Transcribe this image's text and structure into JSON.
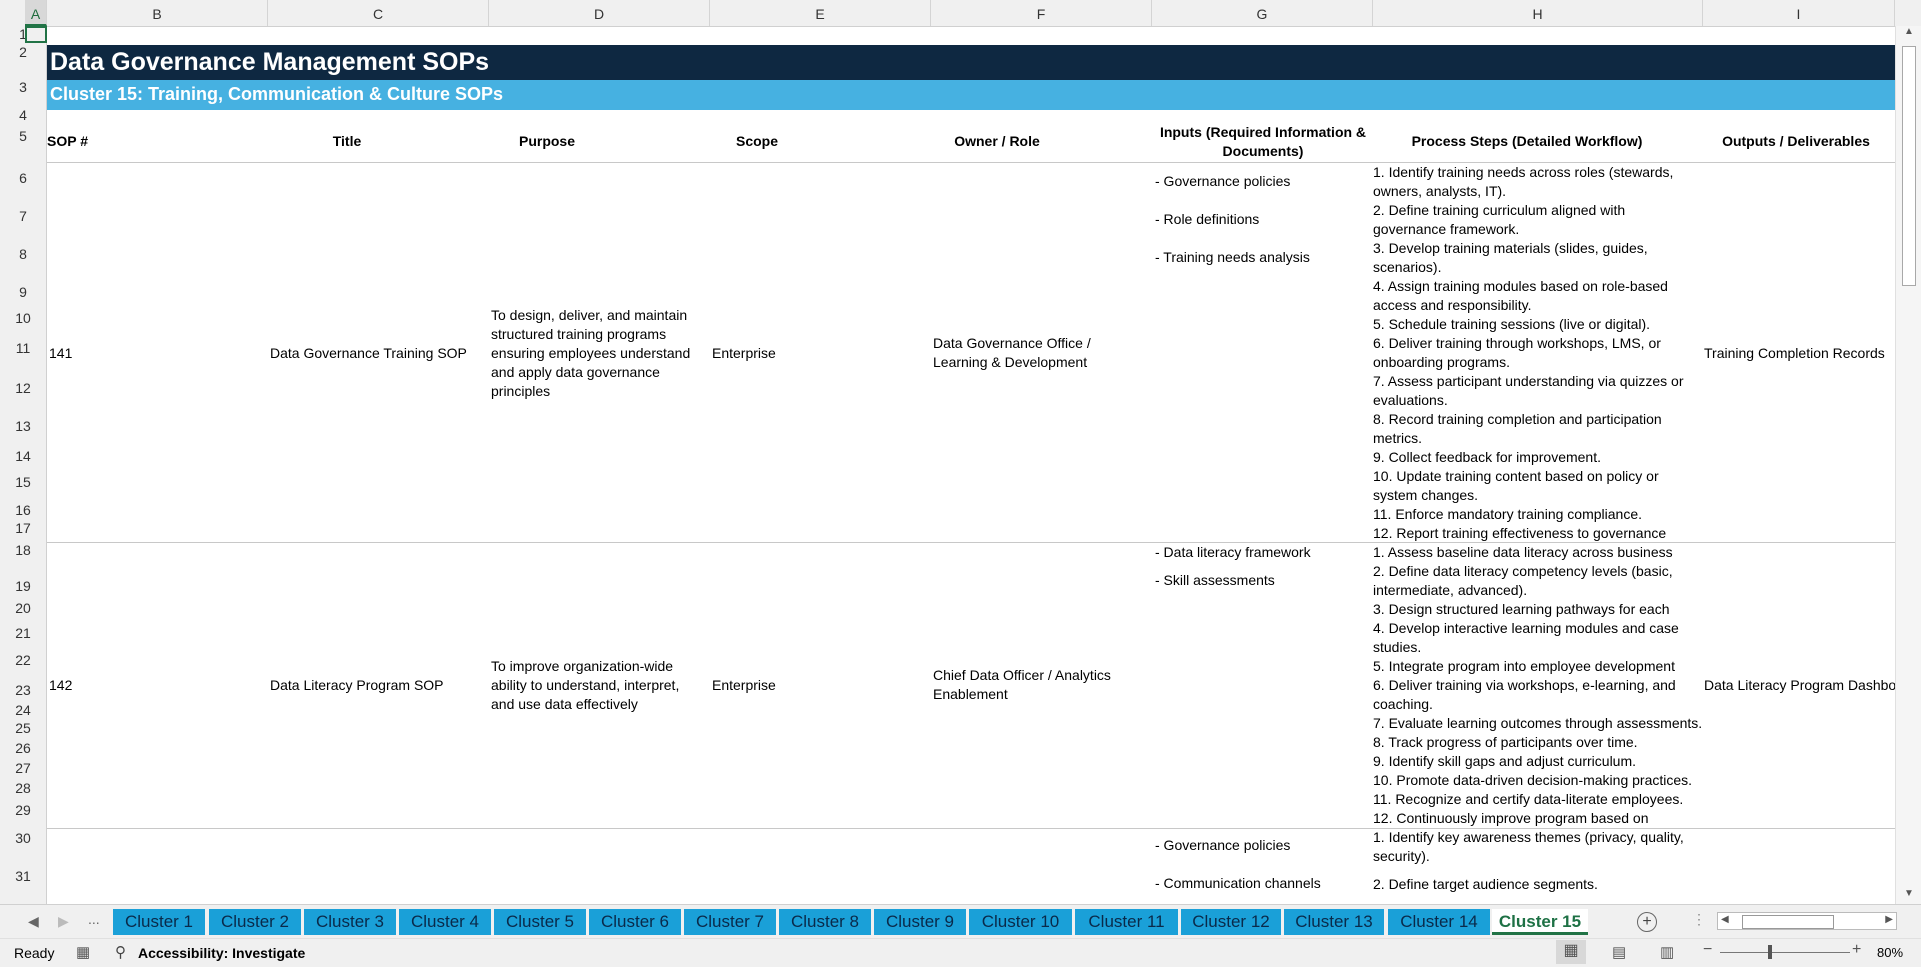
{
  "columns": [
    "A",
    "B",
    "C",
    "D",
    "E",
    "F",
    "G",
    "H",
    "I"
  ],
  "rows": [
    "1",
    "2",
    "3",
    "4",
    "5",
    "6",
    "7",
    "8",
    "9",
    "10",
    "11",
    "12",
    "13",
    "14",
    "15",
    "16",
    "17",
    "18",
    "19",
    "20",
    "21",
    "22",
    "23",
    "24",
    "25",
    "26",
    "27",
    "28",
    "29",
    "30",
    "31"
  ],
  "sheet": {
    "title": "Data Governance Management SOPs",
    "subtitle": "Cluster 15: Training, Communication & Culture SOPs",
    "headers": {
      "sop": "SOP #",
      "title": "Title",
      "purpose": "Purpose",
      "scope": "Scope",
      "owner": "Owner / Role",
      "inputs": "Inputs (Required Information & Documents)",
      "steps": "Process Steps (Detailed Workflow)",
      "outputs": "Outputs / Deliverables"
    },
    "records": [
      {
        "sop": "141",
        "title": "Data Governance Training SOP",
        "purpose": "To design, deliver, and maintain structured training programs ensuring employees understand and apply data governance principles",
        "scope": "Enterprise",
        "owner": "Data Governance Office / Learning & Development",
        "inputs": [
          "- Governance policies",
          "- Role definitions",
          "- Training needs analysis"
        ],
        "steps": [
          "1. Identify training needs across roles (stewards,",
          "owners, analysts, IT).",
          "2. Define training curriculum aligned with",
          "governance framework.",
          "3. Develop training materials (slides, guides,",
          "scenarios).",
          "4. Assign training modules based on role-based",
          "access and responsibility.",
          "5. Schedule training sessions (live or digital).",
          "6. Deliver training through workshops, LMS, or",
          "onboarding programs.",
          "7. Assess participant understanding via quizzes or",
          "evaluations.",
          "8. Record training completion and participation",
          "metrics.",
          "9. Collect feedback for improvement.",
          "10. Update training content based on policy or",
          "system changes.",
          "11. Enforce mandatory training compliance.",
          "12. Report training effectiveness to governance"
        ],
        "outputs": "Training Completion Records"
      },
      {
        "sop": "142",
        "title": "Data Literacy Program SOP",
        "purpose": "To improve organization-wide ability to understand, interpret, and use data effectively",
        "scope": "Enterprise",
        "owner": "Chief Data Officer / Analytics Enablement",
        "inputs": [
          "- Data literacy framework",
          "- Skill assessments"
        ],
        "steps": [
          "1. Assess baseline data literacy across business",
          "2. Define data literacy competency levels (basic,",
          "intermediate, advanced).",
          "3. Design structured learning pathways for each",
          "4. Develop interactive learning modules and case",
          "studies.",
          "5. Integrate program into employee development",
          "6. Deliver training via workshops, e-learning, and",
          "coaching.",
          "7. Evaluate learning outcomes through assessments.",
          "8. Track progress of participants over time.",
          "9. Identify skill gaps and adjust curriculum.",
          "10. Promote data-driven decision-making practices.",
          "11. Recognize and certify data-literate employees.",
          "12. Continuously improve program based on"
        ],
        "outputs": "Data Literacy Program Dashboa"
      },
      {
        "inputs": [
          "- Governance policies",
          "- Communication channels"
        ],
        "steps": [
          "1. Identify key awareness themes (privacy, quality,",
          "security).",
          "2. Define target audience segments."
        ]
      }
    ]
  },
  "tabs": [
    "Cluster 1",
    "Cluster 2",
    "Cluster 3",
    "Cluster 4",
    "Cluster 5",
    "Cluster 6",
    "Cluster 7",
    "Cluster 8",
    "Cluster 9",
    "Cluster 10",
    "Cluster 11",
    "Cluster 12",
    "Cluster 13",
    "Cluster 14",
    "Cluster 15"
  ],
  "active_tab": "Cluster 15",
  "nav": {
    "ellipsis": "...",
    "prev": "◀",
    "next": "▶"
  },
  "status": {
    "ready": "Ready",
    "accessibility": "Accessibility: Investigate",
    "zoom": "80%"
  }
}
